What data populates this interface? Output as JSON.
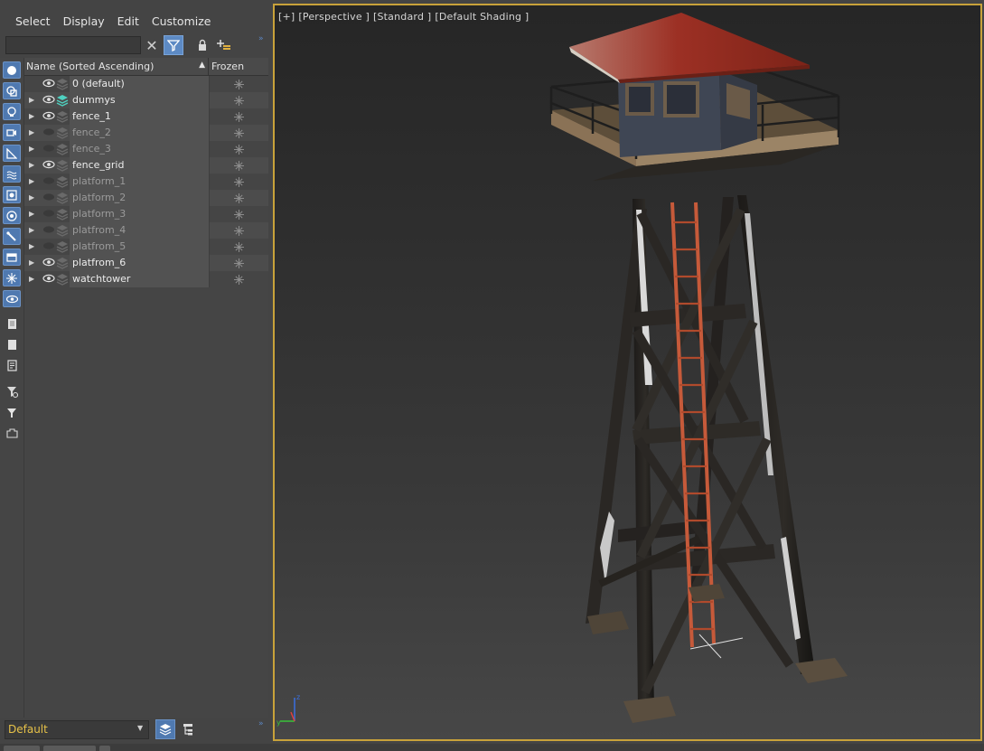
{
  "menu": [
    "Select",
    "Display",
    "Edit",
    "Customize"
  ],
  "search": {
    "value": "",
    "placeholder": ""
  },
  "toolbar": {
    "clear_icon": "close-icon",
    "filter_icon": "filter-icon",
    "lock_icon": "lock-icon",
    "add_layer_icon": "add-layer-icon",
    "more_glyph": "»"
  },
  "table": {
    "col_name": "Name (Sorted Ascending)",
    "col_frozen": "Frozen",
    "sort_glyph": "▲",
    "rows": [
      {
        "label": "0 (default)",
        "visible": true,
        "expandable": false
      },
      {
        "label": "dummys",
        "visible": true,
        "expandable": true,
        "active": true
      },
      {
        "label": "fence_1",
        "visible": true,
        "expandable": true
      },
      {
        "label": "fence_2",
        "visible": false,
        "expandable": true
      },
      {
        "label": "fence_3",
        "visible": false,
        "expandable": true
      },
      {
        "label": "fence_grid",
        "visible": true,
        "expandable": true
      },
      {
        "label": "platform_1",
        "visible": false,
        "expandable": true
      },
      {
        "label": "platform_2",
        "visible": false,
        "expandable": true
      },
      {
        "label": "platform_3",
        "visible": false,
        "expandable": true
      },
      {
        "label": "platfrom_4",
        "visible": false,
        "expandable": true
      },
      {
        "label": "platfrom_5",
        "visible": false,
        "expandable": true
      },
      {
        "label": "platfrom_6",
        "visible": true,
        "expandable": true
      },
      {
        "label": "watchtower",
        "visible": true,
        "expandable": true
      }
    ]
  },
  "bottom": {
    "layer_value": "Default"
  },
  "viewport": {
    "labels": [
      "[+]",
      "[Perspective ]",
      "[Standard ]",
      "[Default Shading ]"
    ]
  },
  "colors": {
    "accent_blue": "#4f79b0",
    "viewport_border": "#c8a23a",
    "layer_text": "#e7c248"
  }
}
